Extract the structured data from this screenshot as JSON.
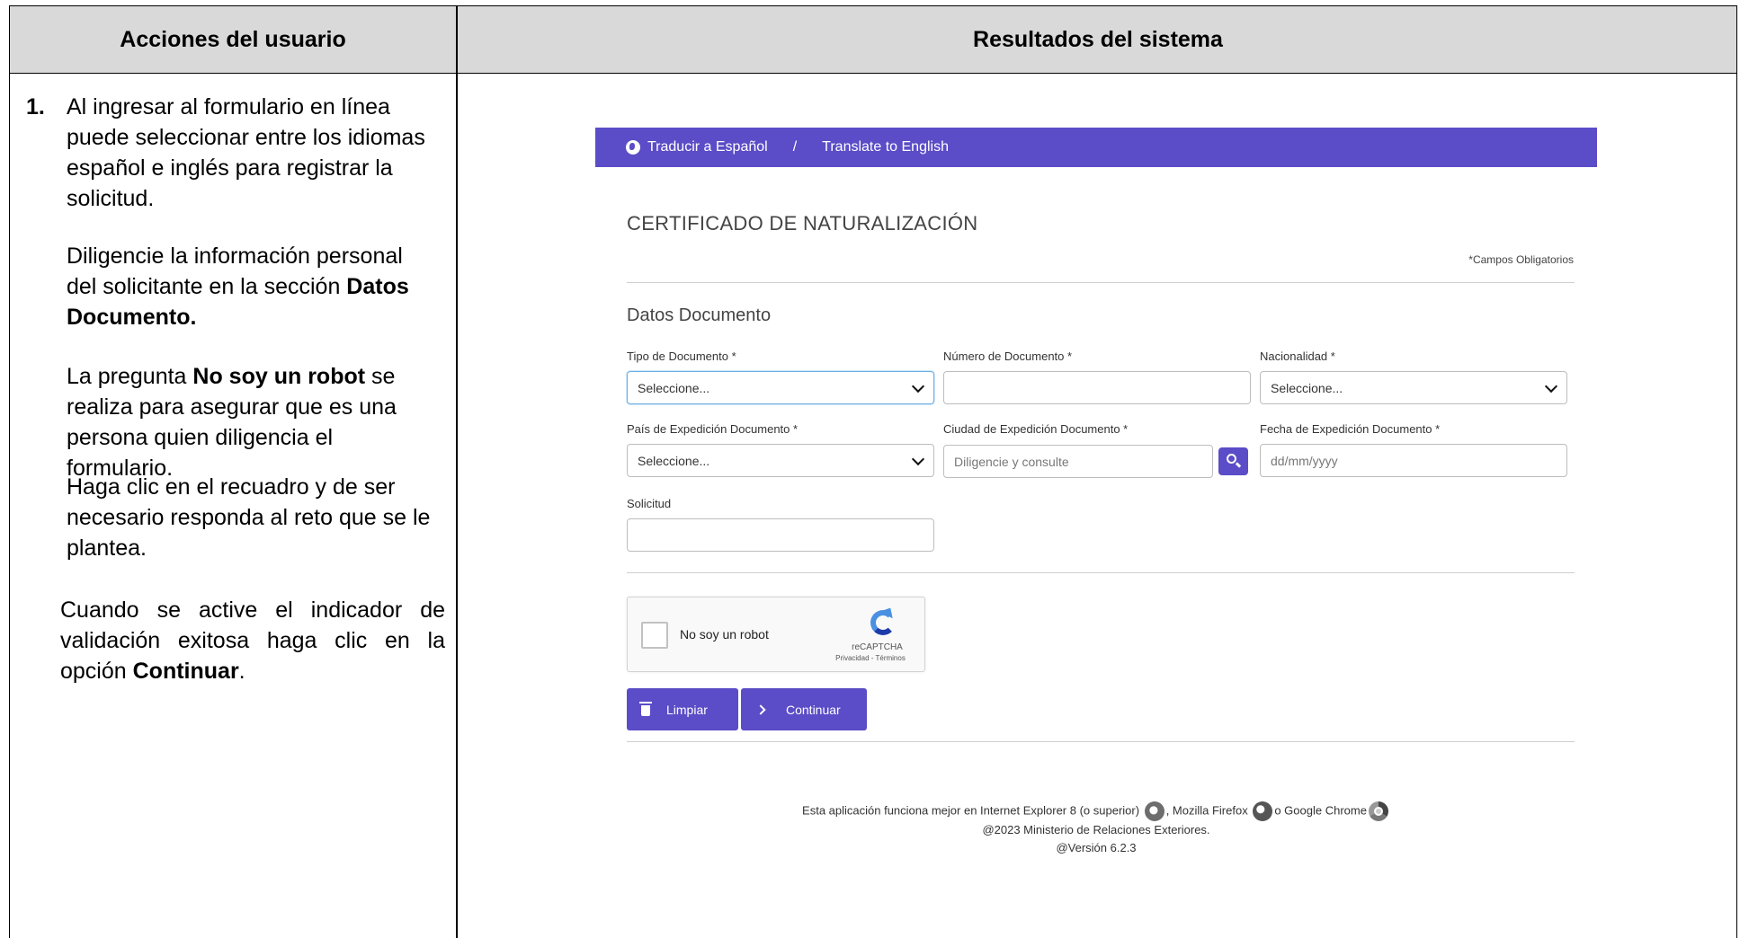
{
  "table": {
    "header_left": "Acciones del usuario",
    "header_right": "Resultados del sistema"
  },
  "instructions": {
    "step_number": "1.",
    "p1": "Al ingresar al formulario en línea puede seleccionar entre los idiomas español e inglés para registrar la solicitud.",
    "p2_pre": "Diligencie la información personal del solicitante en la sección ",
    "p2_bold": "Datos Documento.",
    "p3_pre": "La pregunta ",
    "p3_bold": "No soy un robot",
    "p3_post": " se realiza para asegurar que es una persona quien diligencia el formulario.",
    "p4": "Haga clic en el recuadro y de ser necesario responda al reto que se le plantea.",
    "p5_pre": "Cuando se active el indicador de validación exitosa haga clic en la opción ",
    "p5_bold": "Continuar",
    "p5_post": "."
  },
  "lang_bar": {
    "spanish": "Traducir a Español",
    "separator": "/",
    "english": "Translate to English",
    "icon": "globe-icon"
  },
  "form": {
    "title": "CERTIFICADO DE NATURALIZACIÓN",
    "required_note": "*Campos Obligatorios",
    "section_title": "Datos Documento",
    "fields": {
      "tipo_documento": {
        "label": "Tipo de Documento *",
        "value": "Seleccione..."
      },
      "numero_documento": {
        "label": "Número de Documento *",
        "value": ""
      },
      "nacionalidad": {
        "label": "Nacionalidad *",
        "value": "Seleccione..."
      },
      "pais_expedicion": {
        "label": "País de Expedición Documento *",
        "value": "Seleccione..."
      },
      "ciudad_expedicion": {
        "label": "Ciudad de Expedición Documento *",
        "placeholder": "Diligencie y consulte"
      },
      "fecha_expedicion": {
        "label": "Fecha de Expedición Documento *",
        "placeholder": "dd/mm/yyyy"
      },
      "solicitud": {
        "label": "Solicitud",
        "value": ""
      }
    },
    "captcha": {
      "label": "No soy un robot",
      "brand": "reCAPTCHA",
      "terms": "Privacidad - Términos"
    },
    "buttons": {
      "clear": "Limpiar",
      "continue": "Continuar"
    }
  },
  "footer": {
    "line1_pre": "Esta aplicación funciona mejor en Internet Explorer 8 (o superior)",
    "line1_mid1": ", Mozilla Firefox",
    "line1_mid2": "o Google Chrome",
    "line2": "@2023 Ministerio de Relaciones Exteriores.",
    "line3": "@Versión 6.2.3"
  },
  "colors": {
    "accent": "#5b4cc7",
    "header_bg": "#d9d9d9"
  }
}
